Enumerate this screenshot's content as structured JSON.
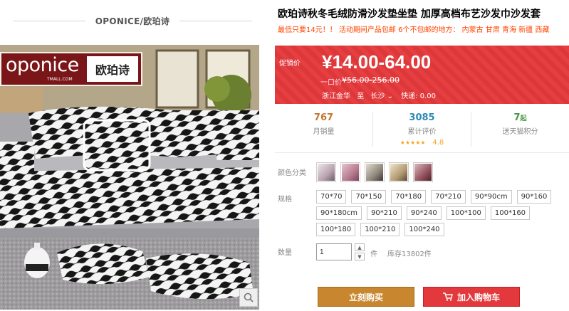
{
  "store": {
    "name": "OPONICE/欧珀诗"
  },
  "photo": {
    "logo_en": "oponice",
    "logo_sub": "TMALL.COM",
    "logo_cn": "欧珀诗"
  },
  "product": {
    "title": "欧珀诗秋冬毛绒防滑沙发垫坐垫 加厚高档布艺沙发巾沙发套",
    "subtitle": "最低只要14元！！ 活动期间产品包邮 6个不包邮的地方： 内蒙古 甘肃 青海 新疆 西藏"
  },
  "price_panel": {
    "promo_label": "促销价",
    "price": "¥14.00-64.00",
    "original_label": "一口价",
    "original_price": "¥56.00-256.00",
    "ship_from": "浙江金华",
    "ship_to_label": "至",
    "ship_to": "长沙",
    "delivery": "快递: 0.00"
  },
  "stats": [
    {
      "value": "767",
      "label": "月销量",
      "color": "#c07830"
    },
    {
      "value": "3085",
      "label": "累计评价",
      "color": "#2c8ab4",
      "rating": "4.8"
    },
    {
      "value": "7",
      "value_suffix": "起",
      "label": "送天猫积分",
      "color": "#489641"
    }
  ],
  "colors_label": "颜色分类",
  "swatches": [
    "#d8c8d0",
    "#c9a3b0",
    "#a79c92",
    "#b7a68d",
    "#a06870"
  ],
  "sizes_label": "规格",
  "sizes": [
    "70*70",
    "70*150",
    "70*180",
    "70*210",
    "90*90cm",
    "90*160",
    "90*180cm",
    "90*210",
    "90*240",
    "100*100",
    "100*160",
    "100*180",
    "100*210",
    "100*240"
  ],
  "quantity": {
    "label": "数量",
    "value": "1",
    "unit": "件",
    "stock": "库存13802件"
  },
  "buttons": {
    "buy": "立刻购买",
    "cart": "加入购物车"
  }
}
